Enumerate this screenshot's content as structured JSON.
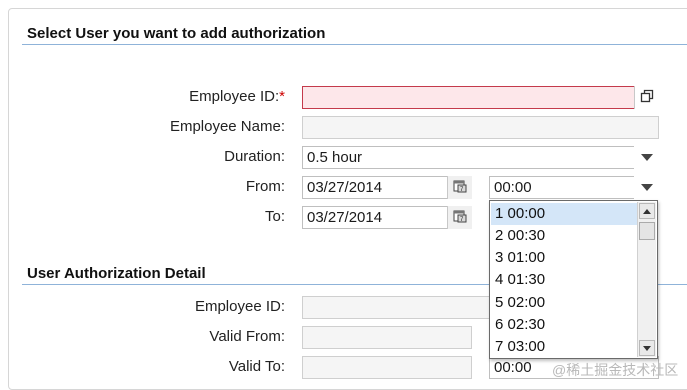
{
  "section1": {
    "title": "Select User you want to add authorization"
  },
  "form": {
    "employee_id_label": "Employee ID:",
    "required_mark": "*",
    "employee_id_value": "",
    "employee_name_label": "Employee Name:",
    "employee_name_value": "",
    "duration_label": "Duration:",
    "duration_value": "0.5 hour",
    "from_label": "From:",
    "from_date": "03/27/2014",
    "from_time": "00:00",
    "to_label": "To:",
    "to_date": "03/27/2014"
  },
  "time_dropdown": {
    "items": [
      "1 00:00",
      "2 00:30",
      "3 01:00",
      "4 01:30",
      "5 02:00",
      "6 02:30",
      "7 03:00"
    ],
    "selected_index": 0
  },
  "section2": {
    "title": "User Authorization Detail",
    "employee_id_label": "Employee ID:",
    "valid_from_label": "Valid From:",
    "valid_to_label": "Valid To:",
    "valid_to_time": "00:00"
  },
  "watermark": "@稀土掘金技术社区",
  "icons": {
    "value_help": "value-help-icon",
    "calendar": "calendar-icon",
    "dropdown": "chevron-down-icon"
  }
}
